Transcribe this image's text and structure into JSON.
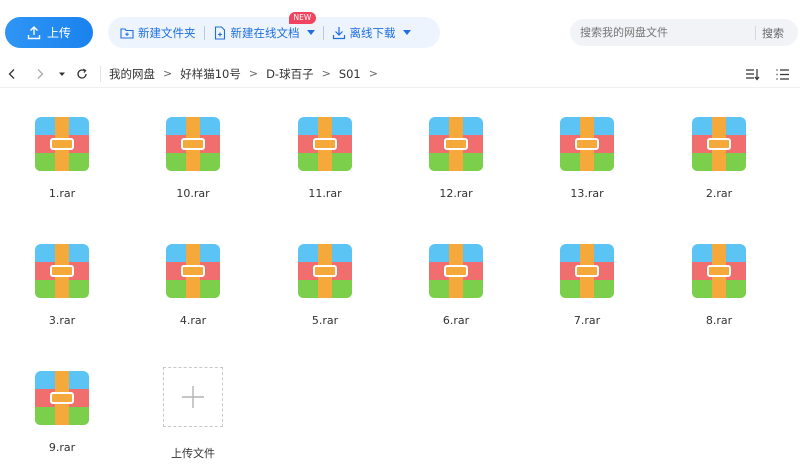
{
  "toolbar": {
    "upload_label": "上传",
    "new_folder_label": "新建文件夹",
    "new_online_doc_label": "新建在线文档",
    "new_badge": "NEW",
    "offline_download_label": "离线下载",
    "search_placeholder": "搜索我的网盘文件",
    "search_button": "搜索"
  },
  "breadcrumb": [
    "我的网盘",
    "好样猫10号",
    "D-球百子",
    "S01"
  ],
  "files": [
    {
      "name": "1.rar"
    },
    {
      "name": "10.rar"
    },
    {
      "name": "11.rar"
    },
    {
      "name": "12.rar"
    },
    {
      "name": "13.rar"
    },
    {
      "name": "2.rar"
    },
    {
      "name": "3.rar"
    },
    {
      "name": "4.rar"
    },
    {
      "name": "5.rar"
    },
    {
      "name": "6.rar"
    },
    {
      "name": "7.rar"
    },
    {
      "name": "8.rar"
    },
    {
      "name": "9.rar"
    }
  ],
  "upload_tile_label": "上传文件",
  "colors": {
    "accent": "#1a82ee",
    "rar_top": "#5bc4f5",
    "rar_mid": "#f06e6e",
    "rar_bottom": "#7ccf4a",
    "rar_strap": "#f5a93a"
  }
}
